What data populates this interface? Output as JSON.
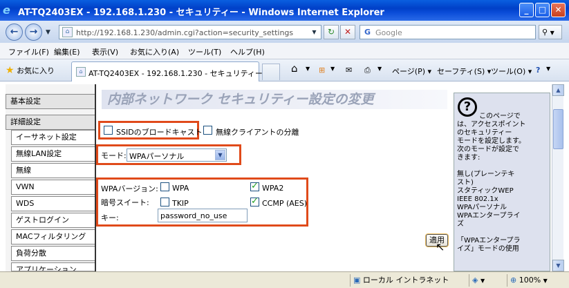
{
  "window": {
    "title": "AT-TQ2403EX - 192.168.1.230 - セキュリティー - Windows Internet Explorer",
    "minimize": "_",
    "maximize": "□",
    "close": "✕"
  },
  "address_bar": {
    "url": "http://192.168.1.230/admin.cgi?action=security_settings",
    "search_placeholder": "Google"
  },
  "menu": [
    "ファイル(F)",
    "編集(E)",
    "表示(V)",
    "お気に入り(A)",
    "ツール(T)",
    "ヘルプ(H)"
  ],
  "favorites_bar": {
    "favorites_label": "お気に入り",
    "tab_title": "AT-TQ2403EX - 192.168.1.230 - セキュリティー",
    "page_menu": "ページ(P)",
    "safety_menu": "セーフティ(S)",
    "tools_menu": "ツール(O)"
  },
  "left_nav": [
    {
      "label": "基本設定",
      "type": "parent"
    },
    {
      "label": "詳細設定",
      "type": "parent"
    },
    {
      "label": "イーサネット設定",
      "type": "sub"
    },
    {
      "label": "無線LAN設定",
      "type": "sub"
    },
    {
      "label": "無線",
      "type": "sub"
    },
    {
      "label": "VWN",
      "type": "sub"
    },
    {
      "label": "WDS",
      "type": "sub"
    },
    {
      "label": "ゲストログイン",
      "type": "sub"
    },
    {
      "label": "MACフィルタリング",
      "type": "sub"
    },
    {
      "label": "負荷分散",
      "type": "sub"
    },
    {
      "label": "アプリケーション",
      "type": "sub"
    }
  ],
  "main": {
    "page_title": "内部ネットワーク セキュリティー設定の変更",
    "broadcast_ssid_label": "SSIDのブロードキャスト",
    "broadcast_ssid_checked": false,
    "station_isolation_label": "無線クライアントの分離",
    "station_isolation_checked": false,
    "mode_label": "モード:",
    "mode_value": "WPAパーソナル",
    "wpa_version_label": "WPAバージョン:",
    "wpa_option_label": "WPA",
    "wpa_checked": false,
    "wpa2_option_label": "WPA2",
    "wpa2_checked": true,
    "cipher_label": "暗号スイート:",
    "tkip_label": "TKIP",
    "tkip_checked": false,
    "ccmp_label": "CCMP (AES)",
    "ccmp_checked": true,
    "key_label": "キー:",
    "key_value": "password_no_use",
    "apply_button": "適用"
  },
  "help": {
    "icon": "?",
    "text": "このページで\nは、アクセスポイント\nのセキュリティー\nモードを設定します。\n次のモードが設定で\nきます:\n\n無し(プレーンテキ\nスト)\nスタティックWEP\nIEEE 802.1x\nWPAパーソナル\nWPAエンタープライ\nズ\n\n「WPAエンタープラ\nイズ」モードの使用"
  },
  "status_bar": {
    "zone": "ローカル イントラネット",
    "zoom": "100%"
  }
}
